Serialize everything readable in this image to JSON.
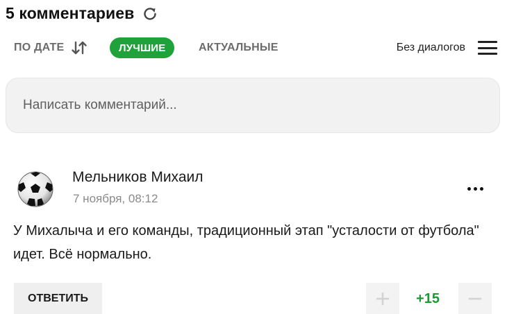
{
  "header": {
    "title": "5 комментариев",
    "refresh_icon": "refresh-icon"
  },
  "sort": {
    "by_date_label": "ПО ДАТЕ",
    "sort_icon": "sort-arrows-icon",
    "best_label": "ЛУЧШИЕ",
    "actual_label": "АКТУАЛЬНЫЕ",
    "active": "ЛУЧШИЕ",
    "active_color": "#1fa239"
  },
  "view": {
    "label": "Без диалогов",
    "menu_icon": "hamburger-menu-icon"
  },
  "composer": {
    "placeholder": "Написать комментарий..."
  },
  "comments": [
    {
      "avatar": "soccer-ball-avatar",
      "author": "Мельников Михаил",
      "date": "7 ноября, 08:12",
      "text": "У Михалыча и его команды, традиционный этап \"усталости от футбола\" идет. Всё нормально.",
      "reply_label": "ОТВЕТИТЬ",
      "score": "+15",
      "score_color": "#1b9a33",
      "upvote_icon": "plus-icon",
      "downvote_icon": "minus-icon",
      "more_icon": "more-dots-icon"
    }
  ]
}
